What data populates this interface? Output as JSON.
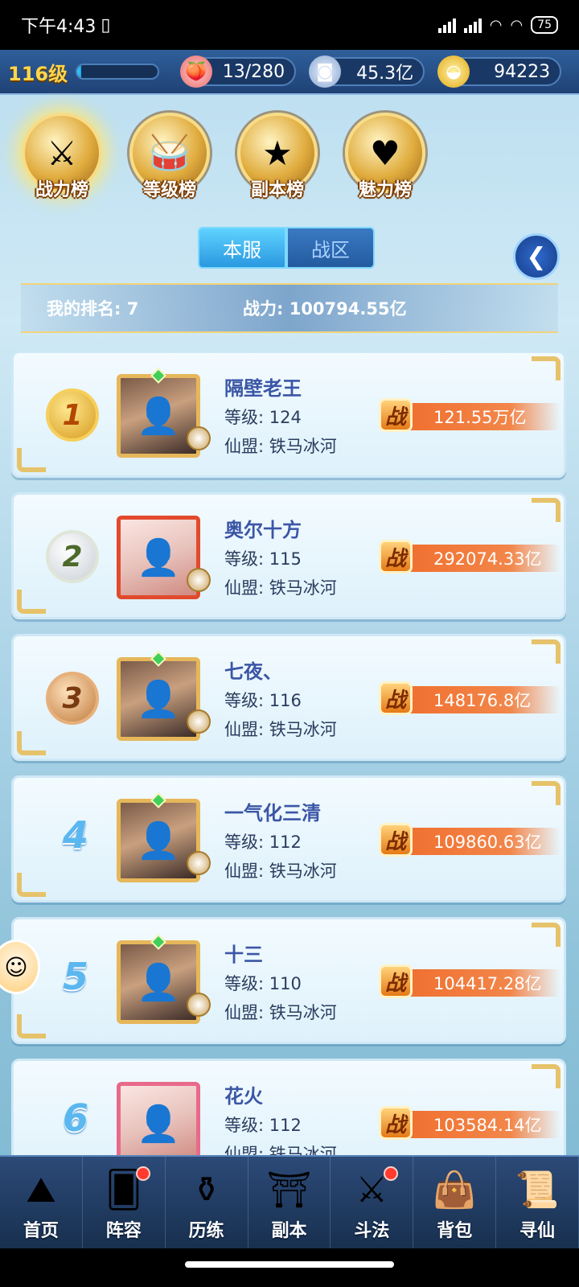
{
  "status_bar": {
    "time": "下午4:43",
    "battery": "75"
  },
  "resources": {
    "level": "116级",
    "xp_fraction": 0.05,
    "peach": "13/280",
    "coins": "45.3亿",
    "gold": "94223"
  },
  "rank_tabs": [
    {
      "label": "战力榜",
      "icon": "sword-emblem-icon"
    },
    {
      "label": "等级榜",
      "icon": "drum-emblem-icon"
    },
    {
      "label": "副本榜",
      "icon": "star-emblem-icon"
    },
    {
      "label": "魅力榜",
      "icon": "heart-emblem-icon"
    }
  ],
  "server_switch": {
    "local": "本服",
    "zone": "战区"
  },
  "my_rank": {
    "rank_label": "我的排名: 7",
    "power_label": "战力: 100794.55亿"
  },
  "players": [
    {
      "rank": "1",
      "name": "隔壁老王",
      "level": "等级: 124",
      "guild": "仙盟: 铁马冰河",
      "power": "121.55万亿"
    },
    {
      "rank": "2",
      "name": "奥尔十方",
      "level": "等级: 115",
      "guild": "仙盟: 铁马冰河",
      "power": "292074.33亿"
    },
    {
      "rank": "3",
      "name": "七夜、",
      "level": "等级: 116",
      "guild": "仙盟: 铁马冰河",
      "power": "148176.8亿"
    },
    {
      "rank": "4",
      "name": "一气化三清",
      "level": "等级: 112",
      "guild": "仙盟: 铁马冰河",
      "power": "109860.63亿"
    },
    {
      "rank": "5",
      "name": "十三",
      "level": "等级: 110",
      "guild": "仙盟: 铁马冰河",
      "power": "104417.28亿"
    },
    {
      "rank": "6",
      "name": "花火",
      "level": "等级: 112",
      "guild": "仙盟: 铁马冰河",
      "power": "103584.14亿"
    }
  ],
  "power_glyph": "战",
  "bottom_nav": [
    {
      "label": "首页",
      "icon": "mountain-icon"
    },
    {
      "label": "阵容",
      "icon": "cards-icon"
    },
    {
      "label": "历练",
      "icon": "gourd-icon"
    },
    {
      "label": "副本",
      "icon": "temple-icon"
    },
    {
      "label": "斗法",
      "icon": "battle-icon"
    },
    {
      "label": "背包",
      "icon": "bag-icon"
    },
    {
      "label": "寻仙",
      "icon": "scroll-icon"
    }
  ]
}
